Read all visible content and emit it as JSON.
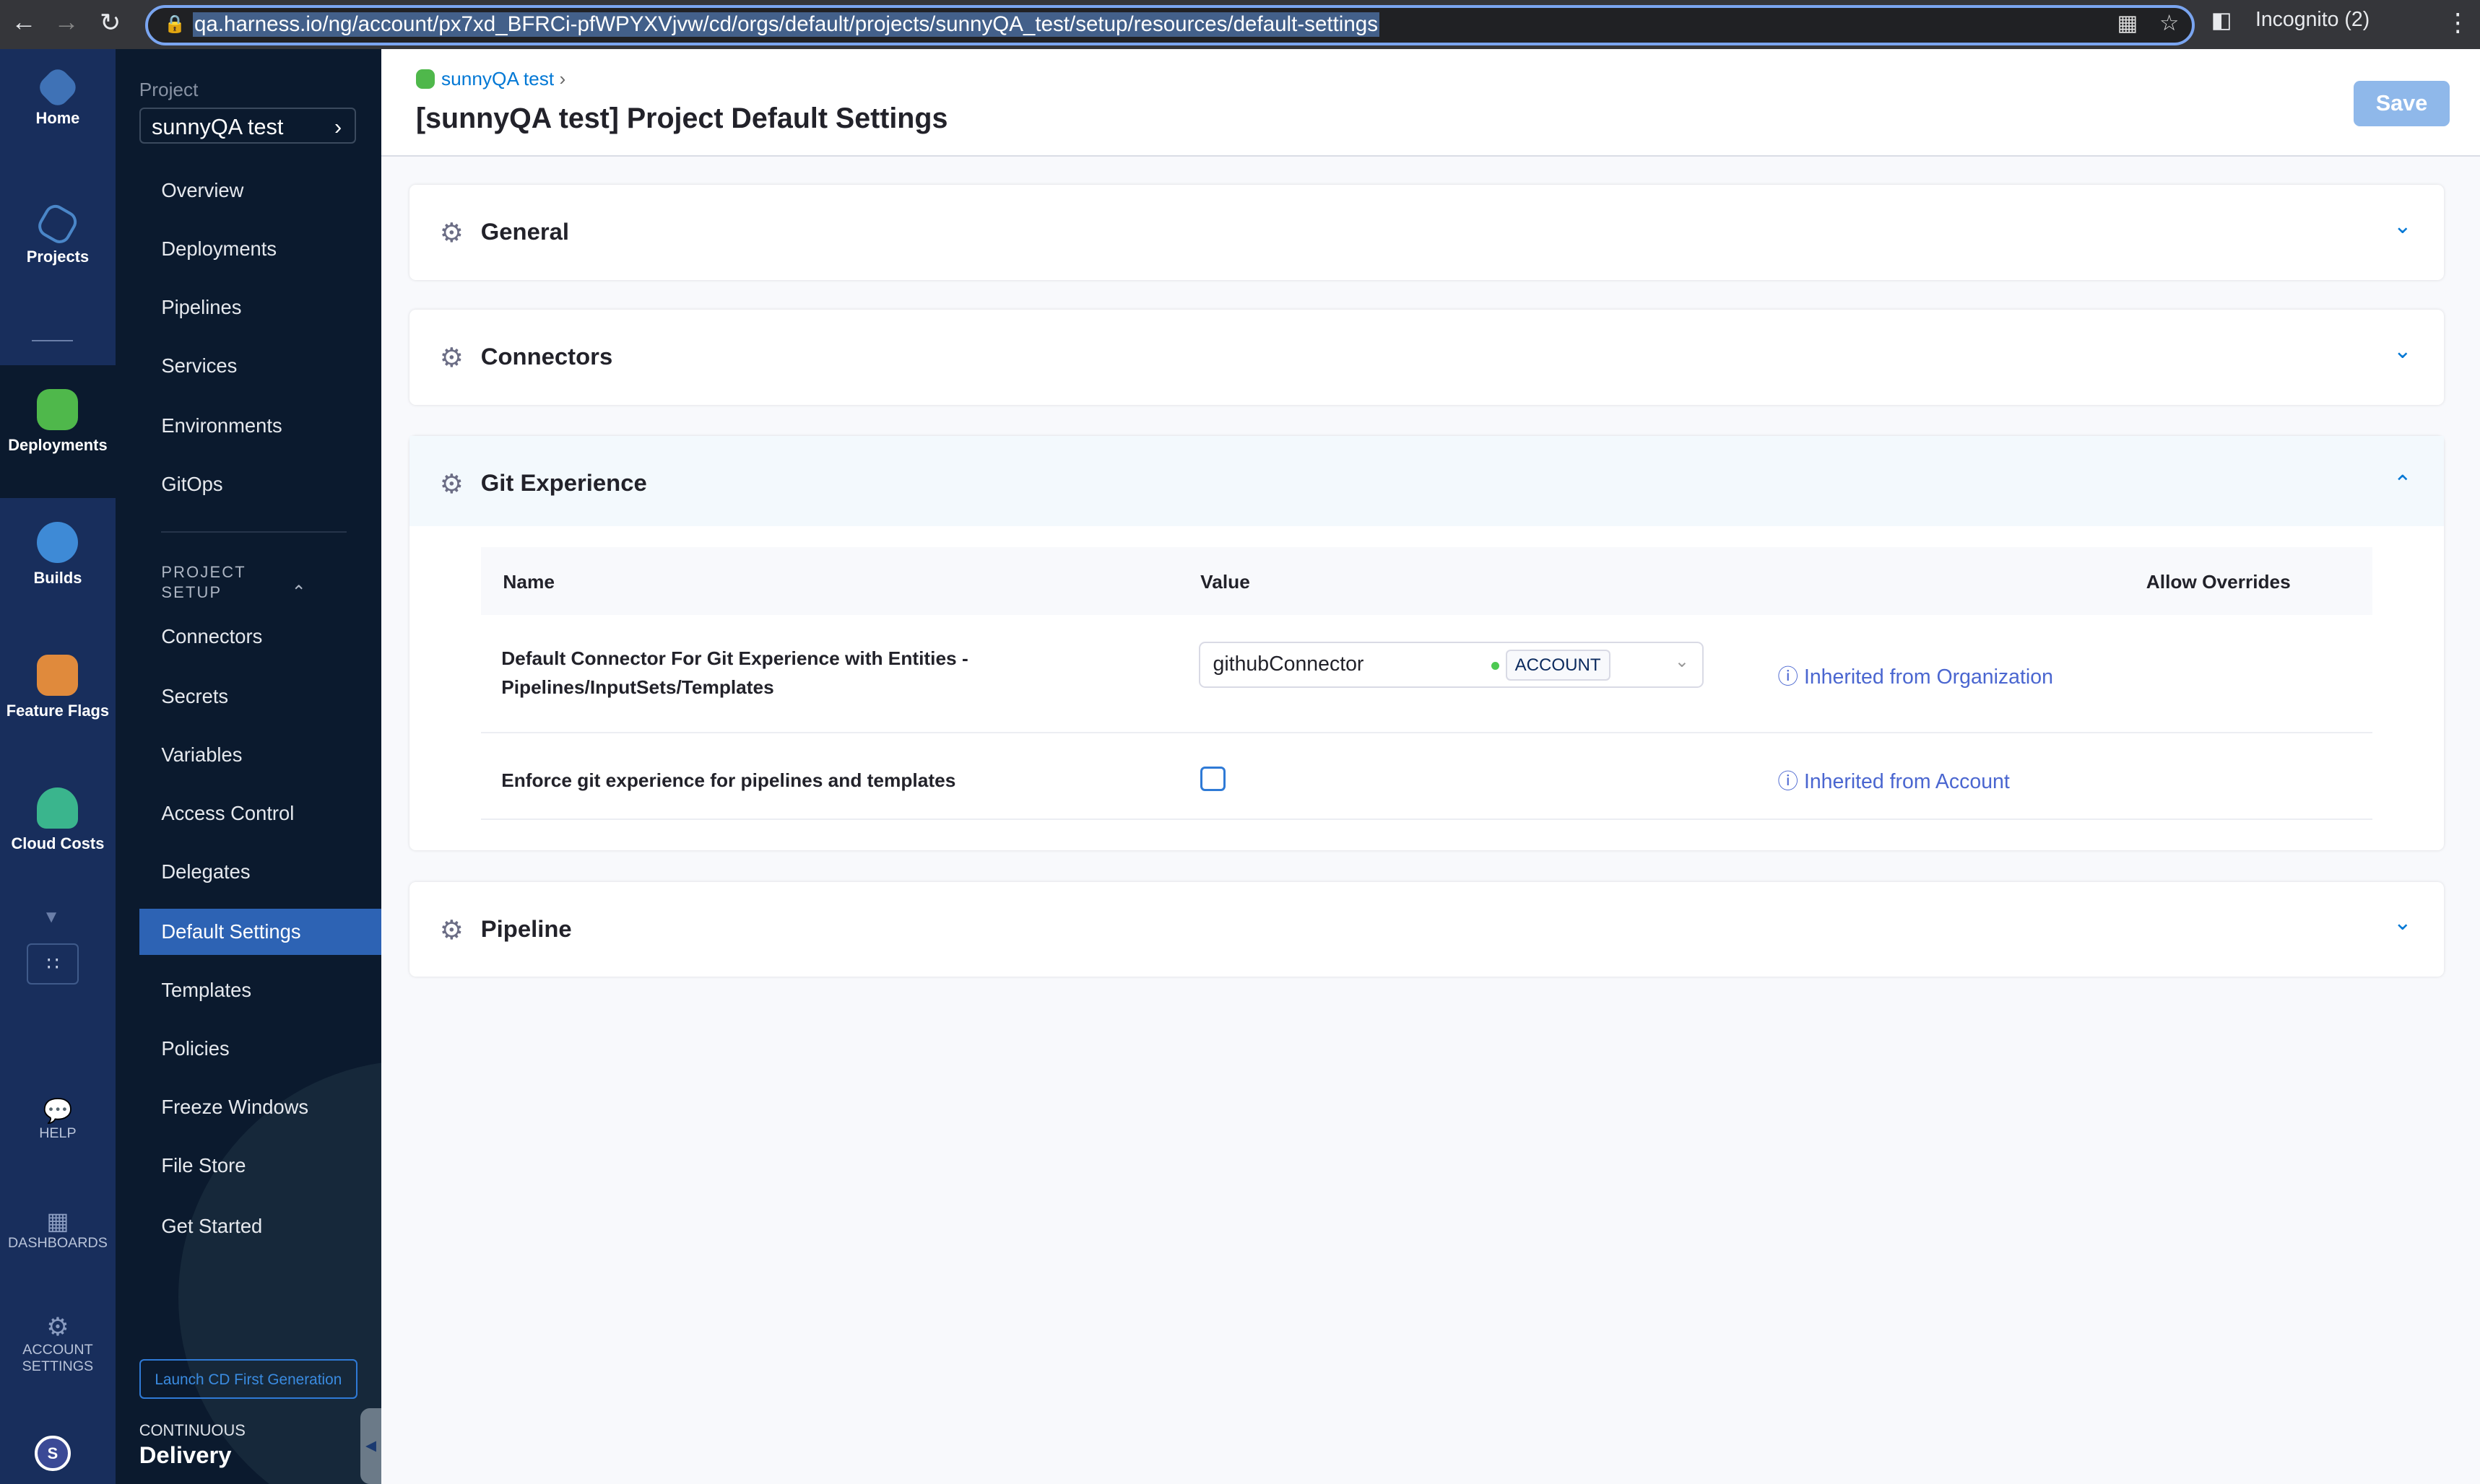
{
  "browser": {
    "url": "qa.harness.io/ng/account/px7xd_BFRCi-pfWPYXVjvw/cd/orgs/default/projects/sunnyQA_test/setup/resources/default-settings",
    "profile": "Incognito (2)"
  },
  "rail": {
    "items": [
      {
        "label": "Home"
      },
      {
        "label": "Projects"
      },
      {
        "label": "Deployments"
      },
      {
        "label": "Builds"
      },
      {
        "label": "Feature Flags"
      },
      {
        "label": "Cloud Costs"
      }
    ],
    "help": "HELP",
    "dashboards": "DASHBOARDS",
    "account_settings": "ACCOUNT SETTINGS",
    "avatar": "S"
  },
  "sidebar": {
    "project_label": "Project",
    "project": "sunnyQA test",
    "items": [
      "Overview",
      "Deployments",
      "Pipelines",
      "Services",
      "Environments",
      "GitOps"
    ],
    "section": "PROJECT SETUP",
    "setup_items": [
      "Connectors",
      "Secrets",
      "Variables",
      "Access Control",
      "Delegates",
      "Default Settings",
      "Templates",
      "Policies",
      "Freeze Windows",
      "File Store",
      "Get Started"
    ],
    "active": "Default Settings",
    "launch": "Launch CD First Generation",
    "module_top": "CONTINUOUS",
    "module": "Delivery"
  },
  "header": {
    "breadcrumb": "sunnyQA test",
    "title": "[sunnyQA test] Project Default Settings",
    "save": "Save"
  },
  "sections": [
    {
      "title": "General"
    },
    {
      "title": "Connectors"
    },
    {
      "title": "Git Experience",
      "expanded": true
    },
    {
      "title": "Pipeline"
    }
  ],
  "git": {
    "columns": [
      "Name",
      "Value",
      "Allow Overrides"
    ],
    "rows": [
      {
        "name": "Default Connector For Git Experience with Entities - Pipelines/InputSets/Templates",
        "value": "githubConnector",
        "scope": "ACCOUNT",
        "inherited": "Inherited from Organization"
      },
      {
        "name": "Enforce git experience for pipelines and templates",
        "checked": false,
        "inherited": "Inherited from Account"
      }
    ]
  }
}
